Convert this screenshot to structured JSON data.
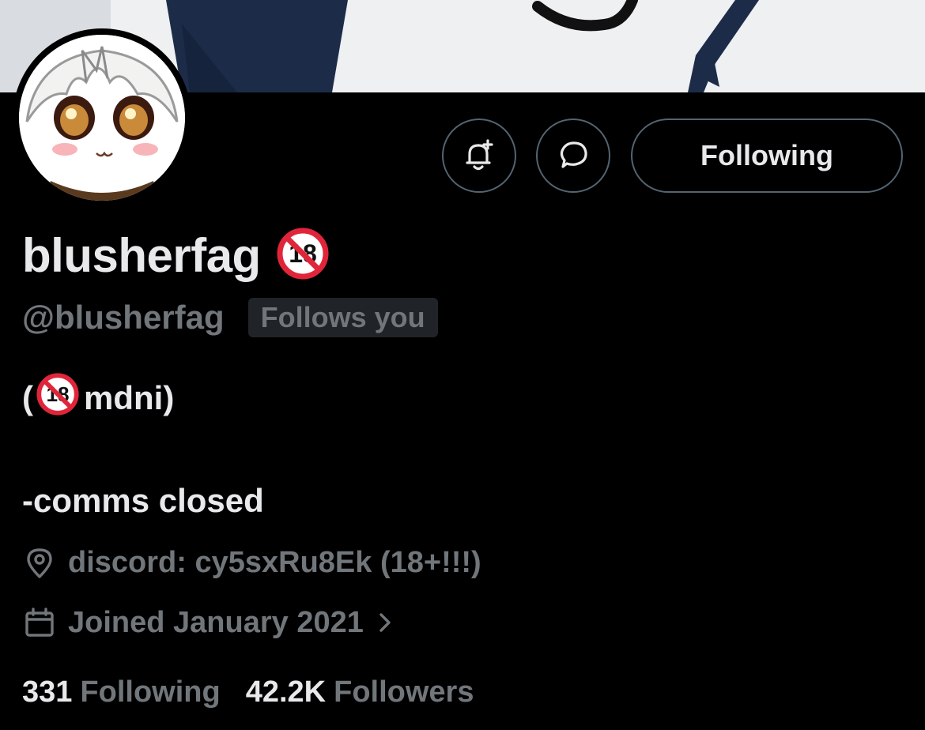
{
  "profile": {
    "display_name": "blusherfag",
    "handle": "@blusherfag",
    "follows_you": "Follows you",
    "bio_line1_open": "(",
    "bio_line1_text": "mdni)",
    "bio_line2": "-comms closed",
    "location": "discord: cy5sxRu8Ek (18+!!!)",
    "joined": "Joined January 2021",
    "following_count": "331",
    "following_label": "Following",
    "followers_count": "42.2K",
    "followers_label": "Followers",
    "badge_icon": "no-one-under-18-emoji"
  },
  "actions": {
    "notify_icon": "bell-plus-icon",
    "message_icon": "message-bubble-icon",
    "following_button": "Following"
  },
  "colors": {
    "background": "#000000",
    "primary_text": "#e7e9ea",
    "secondary_text": "#71767b",
    "border": "#536471",
    "badge_red": "#e0253a"
  }
}
